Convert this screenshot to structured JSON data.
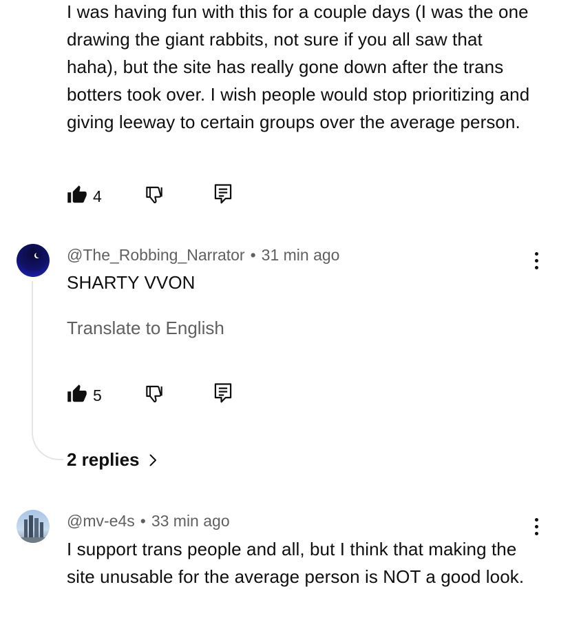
{
  "comments": [
    {
      "text": "I was having fun with this for a couple days (I was the one drawing the giant rabbits, not sure if you all saw that haha), but the site has really gone down after the trans botters took over. I wish people would stop prioritizing and giving leeway to certain groups over the average person.",
      "likes": "4"
    },
    {
      "username": "@The_Robbing_Narrator",
      "separator": "•",
      "time": "31 min ago",
      "text": "SHARTY VVON",
      "translate_label": "Translate to English",
      "likes": "5",
      "replies_label": "2 replies"
    },
    {
      "username": "@mv-e4s",
      "separator": "•",
      "time": "33 min ago",
      "text": "I support trans people and all, but I think that making the site unusable for the average person is NOT a good look."
    }
  ],
  "icons": {
    "like": "thumbs-up-icon",
    "dislike": "thumbs-down-icon",
    "reply": "reply-comment-icon",
    "more": "more-vert-icon",
    "chevron": "chevron-right-icon"
  },
  "colors": {
    "text": "#0f0f0f",
    "secondary": "#606060",
    "avatar1": "#1a2bd6",
    "thread_line": "#e5e5e5"
  }
}
